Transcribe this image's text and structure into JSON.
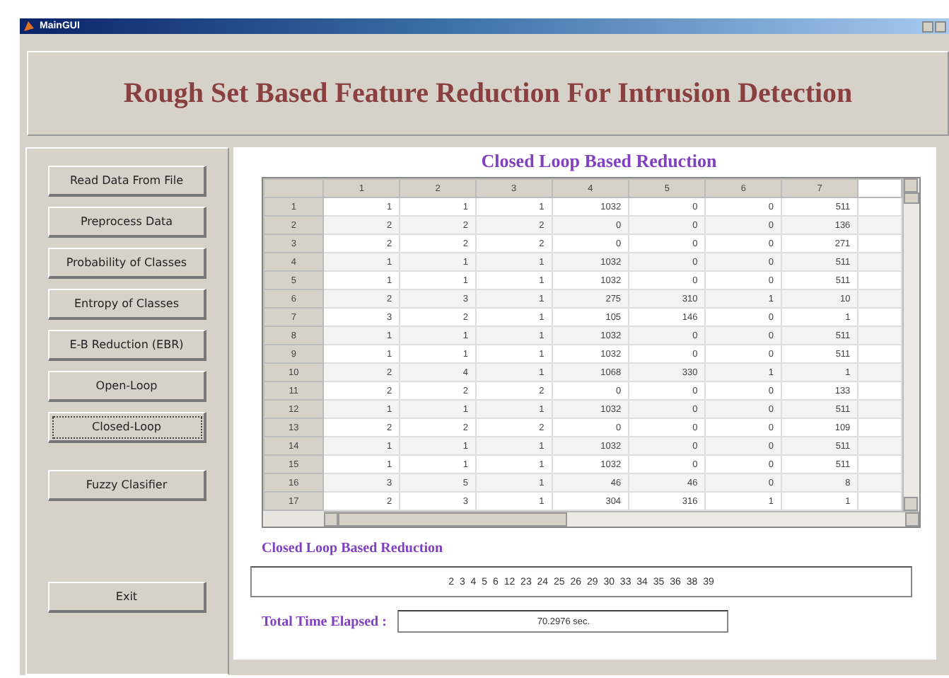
{
  "window": {
    "title": "MainGUI"
  },
  "heading": "Rough Set Based Feature Reduction For Intrusion Detection",
  "buttons": [
    {
      "label": "Read Data From File",
      "selected": false
    },
    {
      "label": "Preprocess Data",
      "selected": false
    },
    {
      "label": "Probability of Classes",
      "selected": false
    },
    {
      "label": "Entropy of Classes",
      "selected": false
    },
    {
      "label": "E-B Reduction (EBR)",
      "selected": false
    },
    {
      "label": "Open-Loop",
      "selected": false
    },
    {
      "label": "Closed-Loop",
      "selected": true
    },
    {
      "label": "Fuzzy Clasifier",
      "selected": false,
      "kind": "gap"
    },
    {
      "label": "Exit",
      "selected": false,
      "kind": "bottom"
    }
  ],
  "panel_title": "Closed Loop Based Reduction",
  "table": {
    "columns": [
      "1",
      "2",
      "3",
      "4",
      "5",
      "6",
      "7"
    ],
    "rows": [
      {
        "label": "1",
        "cells": [
          "1",
          "1",
          "1",
          "1032",
          "0",
          "0",
          "511"
        ]
      },
      {
        "label": "2",
        "cells": [
          "2",
          "2",
          "2",
          "0",
          "0",
          "0",
          "136"
        ]
      },
      {
        "label": "3",
        "cells": [
          "2",
          "2",
          "2",
          "0",
          "0",
          "0",
          "271"
        ]
      },
      {
        "label": "4",
        "cells": [
          "1",
          "1",
          "1",
          "1032",
          "0",
          "0",
          "511"
        ]
      },
      {
        "label": "5",
        "cells": [
          "1",
          "1",
          "1",
          "1032",
          "0",
          "0",
          "511"
        ]
      },
      {
        "label": "6",
        "cells": [
          "2",
          "3",
          "1",
          "275",
          "310",
          "1",
          "10"
        ]
      },
      {
        "label": "7",
        "cells": [
          "3",
          "2",
          "1",
          "105",
          "146",
          "0",
          "1"
        ]
      },
      {
        "label": "8",
        "cells": [
          "1",
          "1",
          "1",
          "1032",
          "0",
          "0",
          "511"
        ]
      },
      {
        "label": "9",
        "cells": [
          "1",
          "1",
          "1",
          "1032",
          "0",
          "0",
          "511"
        ]
      },
      {
        "label": "10",
        "cells": [
          "2",
          "4",
          "1",
          "1068",
          "330",
          "1",
          "1"
        ]
      },
      {
        "label": "11",
        "cells": [
          "2",
          "2",
          "2",
          "0",
          "0",
          "0",
          "133"
        ]
      },
      {
        "label": "12",
        "cells": [
          "1",
          "1",
          "1",
          "1032",
          "0",
          "0",
          "511"
        ]
      },
      {
        "label": "13",
        "cells": [
          "2",
          "2",
          "2",
          "0",
          "0",
          "0",
          "109"
        ]
      },
      {
        "label": "14",
        "cells": [
          "1",
          "1",
          "1",
          "1032",
          "0",
          "0",
          "511"
        ]
      },
      {
        "label": "15",
        "cells": [
          "1",
          "1",
          "1",
          "1032",
          "0",
          "0",
          "511"
        ]
      },
      {
        "label": "16",
        "cells": [
          "3",
          "5",
          "1",
          "46",
          "46",
          "0",
          "8"
        ]
      },
      {
        "label": "17",
        "cells": [
          "2",
          "3",
          "1",
          "304",
          "316",
          "1",
          "1"
        ]
      }
    ]
  },
  "result_label": "Closed Loop Based Reduction",
  "result_value": "2 3 4 5 6 12 23 24 25 26 29 30 33 34 35 36 38 39",
  "time_label": "Total Time Elapsed :",
  "time_value": "70.2976 sec."
}
